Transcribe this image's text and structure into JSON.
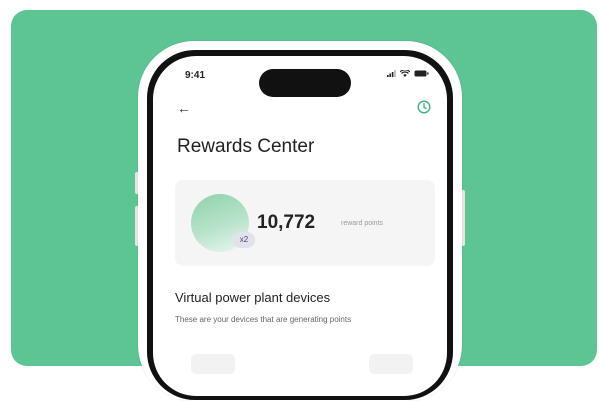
{
  "status_bar": {
    "time": "9:41"
  },
  "header": {
    "back_icon": "back-arrow-icon",
    "history_icon": "clock-icon"
  },
  "page": {
    "title": "Rewards Center"
  },
  "points": {
    "value": "10,772",
    "unit": "reward points",
    "multiplier": "x2"
  },
  "devices_section": {
    "title": "Virtual power plant devices",
    "subtitle": "These are your devices that are generating points"
  },
  "colors": {
    "background": "#5dc494",
    "accent": "#3fb07b",
    "points_gradient_start": "#8fd2ac"
  }
}
